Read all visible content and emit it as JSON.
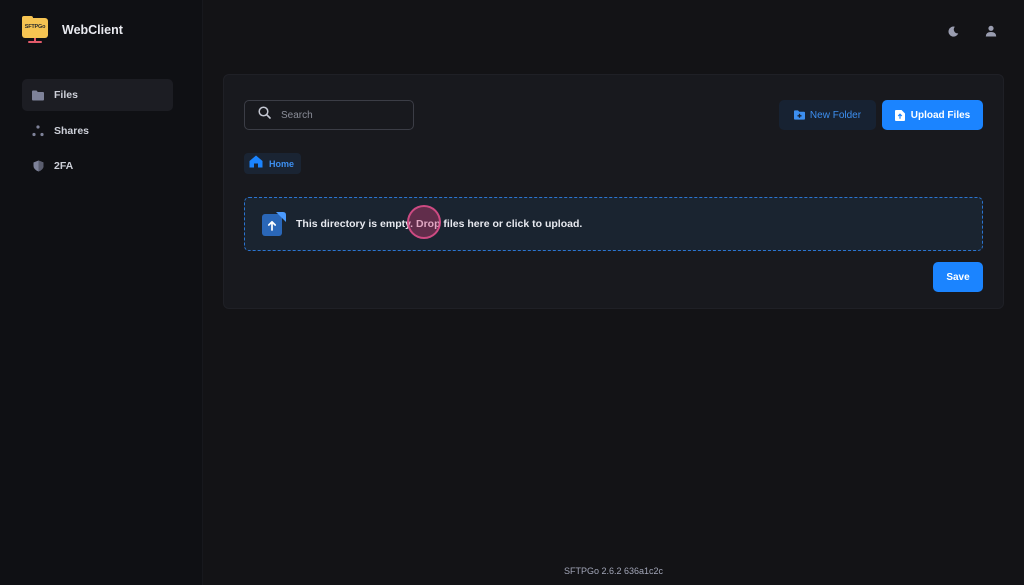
{
  "app": {
    "logo_text": "SFTPGo",
    "name": "WebClient"
  },
  "sidebar": {
    "items": [
      {
        "label": "Files",
        "icon": "folder-icon",
        "active": true
      },
      {
        "label": "Shares",
        "icon": "share-nodes-icon",
        "active": false
      },
      {
        "label": "2FA",
        "icon": "shield-icon",
        "active": false
      }
    ]
  },
  "topbar": {
    "icons": [
      "theme-moon-icon",
      "user-icon"
    ]
  },
  "toolbar": {
    "search_placeholder": "Search",
    "new_folder_label": "New Folder",
    "upload_files_label": "Upload Files"
  },
  "breadcrumb": {
    "home_label": "Home"
  },
  "dropzone": {
    "message": "This directory is empty. Drop files here or click to upload."
  },
  "actions": {
    "save_label": "Save"
  },
  "footer": {
    "version": "SFTPGo 2.6.2 636a1c2c"
  },
  "colors": {
    "accent": "#1b84ff",
    "background": "#131316",
    "card": "#18191e",
    "logo_folder": "#f6c452"
  }
}
